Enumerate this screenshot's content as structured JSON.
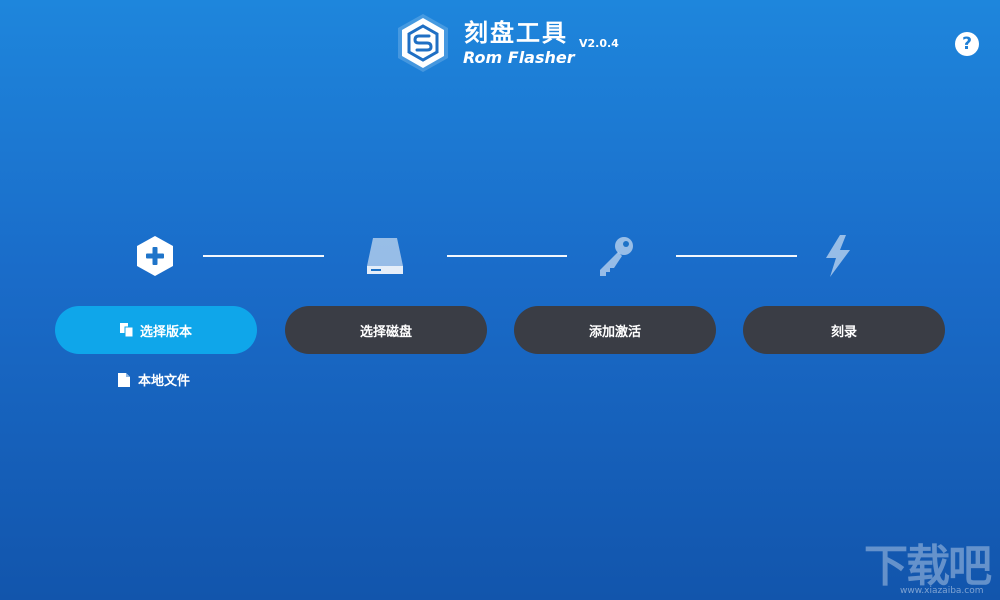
{
  "app": {
    "title_cn": "刻盘工具",
    "title_en": "Rom Flasher",
    "version": "V2.0.4",
    "help_label": "?"
  },
  "steps": [
    {
      "icon": "plus-hexagon-icon",
      "label": "选择版本",
      "active": true
    },
    {
      "icon": "hard-drive-icon",
      "label": "选择磁盘",
      "active": false
    },
    {
      "icon": "key-icon",
      "label": "添加激活",
      "active": false
    },
    {
      "icon": "lightning-icon",
      "label": "刻录",
      "active": false
    }
  ],
  "local_file": {
    "icon": "file-icon",
    "label": "本地文件"
  },
  "watermark": {
    "text": "下载吧",
    "sub": "www.xiazaiba.com"
  },
  "colors": {
    "active_pill": "#0fa6ea",
    "inactive_pill": "#3a3d45",
    "background_top": "#1e86dc",
    "background_bottom": "#1255ac"
  }
}
